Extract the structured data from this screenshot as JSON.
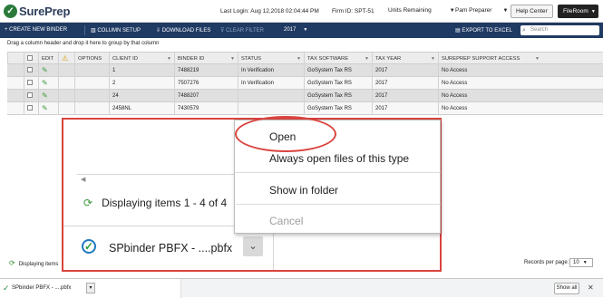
{
  "header": {
    "logo_text": "SurePrep",
    "last_login": "Last Login: Aug 12,2018 02:04:44 PM",
    "firm_id": "Firm ID:  SPT-51",
    "units_remaining": "Units Remaining",
    "user": "Pam Preparer",
    "help_center": "Help Center",
    "fileroom": "FileRoom"
  },
  "toolbar": {
    "create_new_binder": "+ CREATE NEW BINDER",
    "column_setup": "COLUMN SETUP",
    "download_files": "DOWNLOAD FILES",
    "clear_filter": "CLEAR FILTER",
    "year": "2017",
    "export_to_excel": "EXPORT TO EXCEL",
    "search_placeholder": "Search"
  },
  "groupby_hint": "Drag a column header and drop it here to group by that column",
  "grid": {
    "columns": [
      "EDIT",
      "",
      "OPTIONS",
      "CLIENT ID",
      "BINDER ID",
      "STATUS",
      "TAX SOFTWARE",
      "TAX YEAR",
      "SUREPREP SUPPORT ACCESS"
    ],
    "rows": [
      {
        "client_id": "1",
        "binder_id": "7488219",
        "status": "In Verification",
        "tax_software": "GoSystem Tax RS",
        "tax_year": "2017",
        "support_access": "No Access"
      },
      {
        "client_id": "2",
        "binder_id": "7507276",
        "status": "In Verification",
        "tax_software": "GoSystem Tax RS",
        "tax_year": "2017",
        "support_access": "No Access"
      },
      {
        "client_id": "24",
        "binder_id": "7488207",
        "status": "",
        "tax_software": "GoSystem Tax RS",
        "tax_year": "2017",
        "support_access": "No Access"
      },
      {
        "client_id": "2458NL",
        "binder_id": "7430579",
        "status": "",
        "tax_software": "GoSystem Tax RS",
        "tax_year": "2017",
        "support_access": "No Access"
      }
    ]
  },
  "footer": {
    "status_text": "Displaying items",
    "records_per_page": "Records per page:",
    "records_value": "10",
    "download_name": "SPbinder PBFX - ....pbfx",
    "show_all": "Show all"
  },
  "zoom": {
    "status_text": "Displaying items 1 - 4 of 4",
    "download_name": "SPbinder PBFX - ....pbfx"
  },
  "context_menu": {
    "open": "Open",
    "always_open": "Always open files of this type",
    "show_in_folder": "Show in folder",
    "cancel": "Cancel"
  },
  "colors": {
    "toolbar_bg": "#1f3a63",
    "highlight": "#d9443e",
    "accent_green": "#3a9a3a"
  }
}
